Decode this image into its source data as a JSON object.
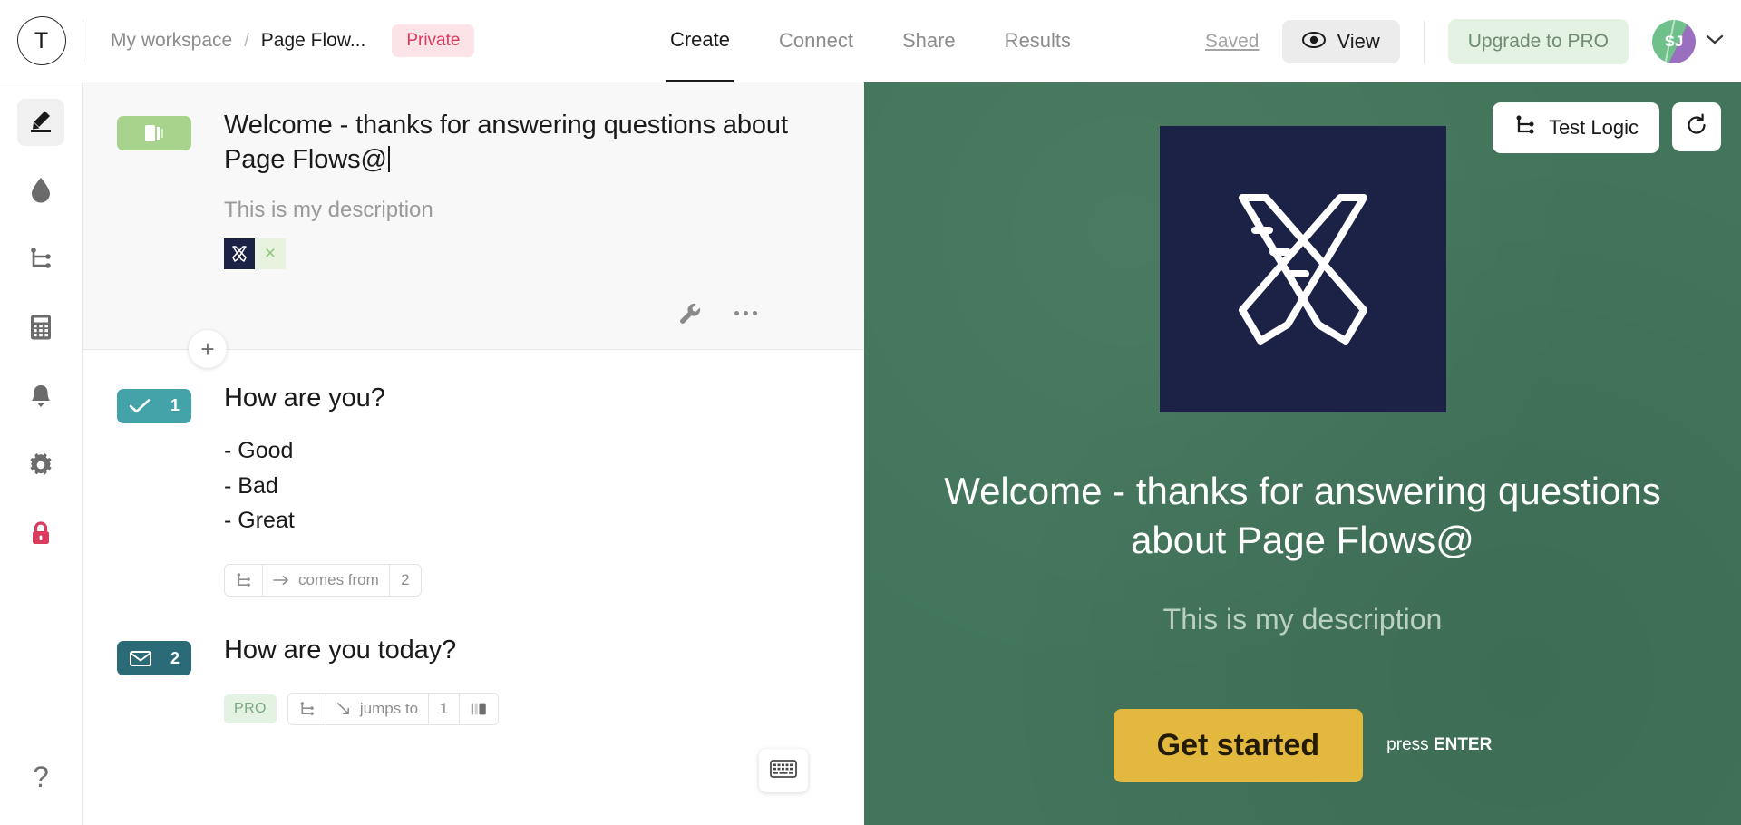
{
  "header": {
    "logo_letter": "T",
    "breadcrumb": {
      "workspace": "My workspace",
      "separator": "/",
      "form_name": "Page Flow...",
      "visibility": "Private"
    },
    "tabs": [
      {
        "label": "Create",
        "active": true
      },
      {
        "label": "Connect",
        "active": false
      },
      {
        "label": "Share",
        "active": false
      },
      {
        "label": "Results",
        "active": false
      }
    ],
    "saved_label": "Saved",
    "view_label": "View",
    "upgrade_label": "Upgrade to PRO",
    "avatar_initials": "SJ",
    "icons": {
      "eye": "eye-icon",
      "chevron": "chevron-down-icon"
    }
  },
  "sidebar": {
    "items": [
      {
        "name": "content",
        "icon": "pencil-highlighter-icon",
        "active": true
      },
      {
        "name": "design",
        "icon": "droplet-icon",
        "active": false
      },
      {
        "name": "logic",
        "icon": "logic-branch-icon",
        "active": false
      },
      {
        "name": "calculator",
        "icon": "calculator-icon",
        "active": false
      },
      {
        "name": "notifications",
        "icon": "bell-icon",
        "active": false
      },
      {
        "name": "settings",
        "icon": "gear-icon",
        "active": false
      },
      {
        "name": "privacy",
        "icon": "lock-icon",
        "active": false
      }
    ],
    "help_label": "?"
  },
  "editor": {
    "welcome_card": {
      "type_icon": "welcome-screen-icon",
      "title": "Welcome - thanks for answering questions about Page Flows@",
      "description": "This is my description",
      "attachment_icon": "pencil-ruler-logo-icon",
      "attachment_remove": "×",
      "tools": {
        "wrench": "wrench-icon",
        "more": "more-options-icon"
      }
    },
    "add_block_label": "+",
    "questions": [
      {
        "number": "1",
        "type_icon": "multiple-choice-icon",
        "title": "How are you?",
        "options": [
          "- Good",
          "- Bad",
          "- Great"
        ],
        "logic": {
          "pro": null,
          "branch_icon": "logic-branch-icon",
          "direction_icon": "arrow-right-icon",
          "text": "comes from",
          "target": "2"
        }
      },
      {
        "number": "2",
        "type_icon": "email-icon",
        "title": "How are you today?",
        "logic": {
          "pro": "PRO",
          "branch_icon": "logic-branch-icon",
          "direction_icon": "arrow-down-right-icon",
          "text": "jumps to",
          "target": "1",
          "extra_icon": "pages-icon"
        }
      }
    ],
    "keyboard_shortcut_icon": "keyboard-icon"
  },
  "preview": {
    "test_logic_label": "Test Logic",
    "test_logic_icon": "logic-branch-icon",
    "refresh_icon": "refresh-icon",
    "logo_icon": "pencil-ruler-logo-icon",
    "title": "Welcome - thanks for answering questions about Page Flows@",
    "description": "This is my description",
    "cta_label": "Get started",
    "hint_prefix": "press ",
    "hint_key": "ENTER"
  },
  "colors": {
    "private_badge": "#d93b5c",
    "upgrade": "#e4f2e4",
    "welcome_chip": "#a8d38d",
    "choice_chip": "#44a3a8",
    "email_chip": "#2b6a77",
    "preview_bg": "#42755b",
    "cta": "#e3b83f",
    "logo_navy": "#1c2246",
    "lock": "#d93b5c"
  }
}
